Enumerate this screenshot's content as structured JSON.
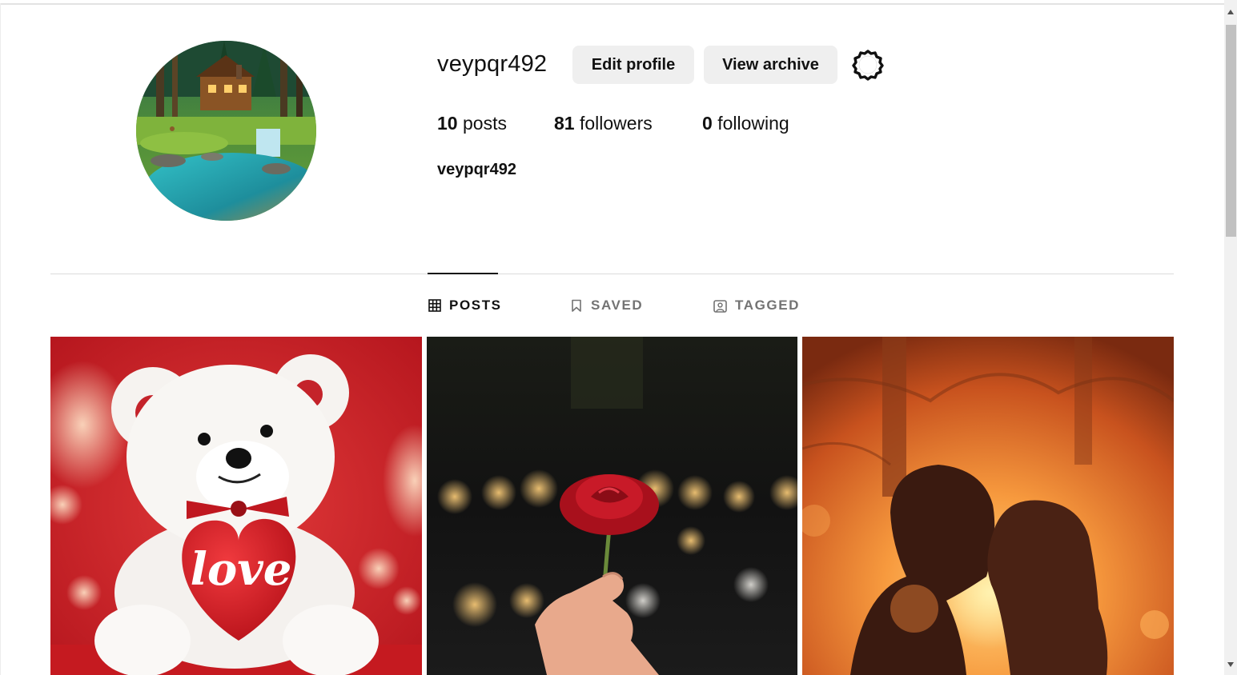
{
  "profile": {
    "username": "veypqr492",
    "full_name": "veypqr492",
    "avatar_icon": "cabin-forest-avatar"
  },
  "actions": {
    "edit_profile": "Edit profile",
    "view_archive": "View archive",
    "settings_icon": "settings-gear-icon"
  },
  "stats": {
    "posts_count": "10",
    "posts_label": "posts",
    "followers_count": "81",
    "followers_label": "followers",
    "following_count": "0",
    "following_label": "following"
  },
  "tabs": [
    {
      "label": "POSTS",
      "icon": "grid-icon",
      "active": true
    },
    {
      "label": "SAVED",
      "icon": "bookmark-icon",
      "active": false
    },
    {
      "label": "TAGGED",
      "icon": "tagged-person-icon",
      "active": false
    }
  ],
  "posts": [
    {
      "image": "teddy-bear-love-heart-photo",
      "overlay_text": "love"
    },
    {
      "image": "hand-holding-red-rose-photo"
    },
    {
      "image": "couple-silhouette-sunset-photo"
    }
  ],
  "colors": {
    "button_bg": "#efefef",
    "text_primary": "#111111",
    "text_secondary": "#737373",
    "divider": "#dbdbdb"
  }
}
